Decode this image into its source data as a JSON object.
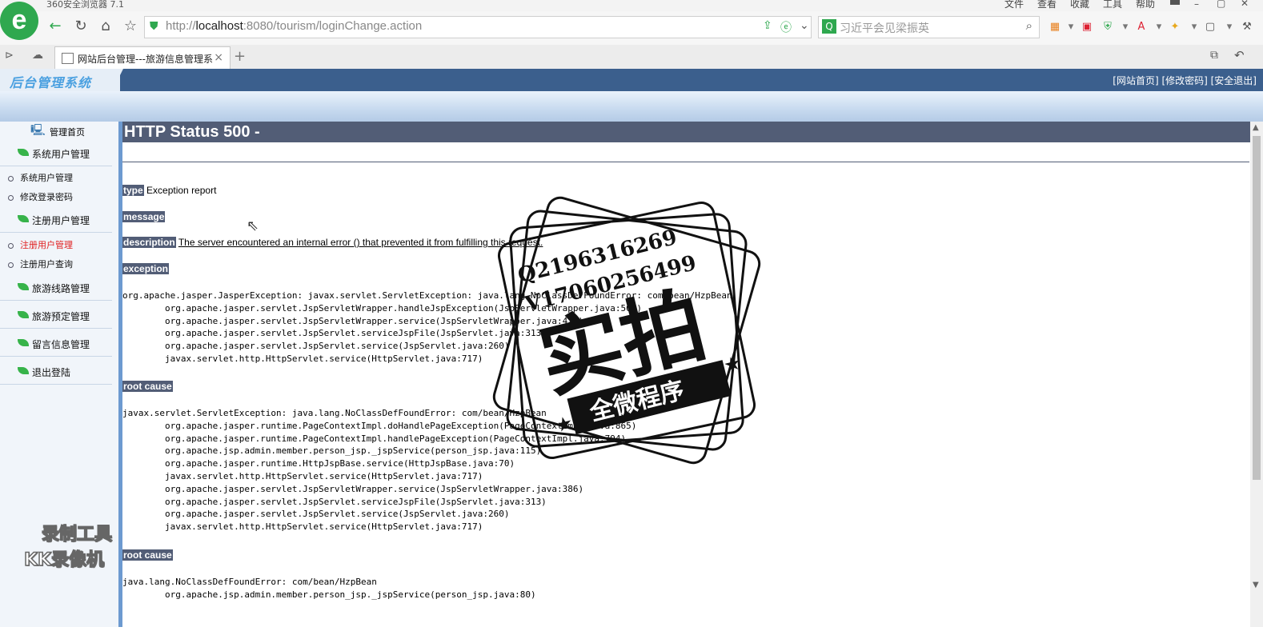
{
  "browser": {
    "app_title": "360安全浏览器 7.1",
    "menu": [
      "文件",
      "查看",
      "收藏",
      "工具",
      "帮助"
    ],
    "url_host": "localhost",
    "url_prefix": "http://",
    "url_rest": ":8080/tourism/loginChange.action",
    "search_placeholder": "习近平会见梁振英",
    "tab_title": "网站后台管理---旅游信息管理系",
    "new_tab": "+"
  },
  "admin": {
    "brand": "后台管理系统",
    "top_links": "[网站首页] [修改密码] [安全退出]",
    "sidebar": {
      "home": "管理首页",
      "groups": [
        {
          "label": "系统用户管理",
          "items": [
            "系统用户管理",
            "修改登录密码"
          ]
        },
        {
          "label": "注册用户管理",
          "items": [
            "注册用户管理",
            "注册用户查询"
          ]
        },
        {
          "label": "旅游线路管理",
          "items": []
        },
        {
          "label": "旅游预定管理",
          "items": []
        },
        {
          "label": "留言信息管理",
          "items": []
        },
        {
          "label": "退出登陆",
          "items": []
        }
      ],
      "active_item_color": "#e02020"
    }
  },
  "error": {
    "title": "HTTP Status 500 -",
    "type_label": "type",
    "type_value": "Exception report",
    "message_label": "message",
    "description_label": "description",
    "description_value": "The server encountered an internal error () that prevented it from fulfilling this request.",
    "exception_label": "exception",
    "exception_trace": "org.apache.jasper.JasperException: javax.servlet.ServletException: java.lang.NoClassDefFoundError: com/bean/HzpBean\n\torg.apache.jasper.servlet.JspServletWrapper.handleJspException(JspServletWrapper.java:500)\n\torg.apache.jasper.servlet.JspServletWrapper.service(JspServletWrapper.java:428)\n\torg.apache.jasper.servlet.JspServlet.serviceJspFile(JspServlet.java:313)\n\torg.apache.jasper.servlet.JspServlet.service(JspServlet.java:260)\n\tjavax.servlet.http.HttpServlet.service(HttpServlet.java:717)",
    "root_cause_label": "root cause",
    "root_cause_trace_1": "javax.servlet.ServletException: java.lang.NoClassDefFoundError: com/bean/HzpBean\n\torg.apache.jasper.runtime.PageContextImpl.doHandlePageException(PageContextImpl.java:865)\n\torg.apache.jasper.runtime.PageContextImpl.handlePageException(PageContextImpl.java:794)\n\torg.apache.jsp.admin.member.person_jsp._jspService(person_jsp.java:115)\n\torg.apache.jasper.runtime.HttpJspBase.service(HttpJspBase.java:70)\n\tjavax.servlet.http.HttpServlet.service(HttpServlet.java:717)\n\torg.apache.jasper.servlet.JspServletWrapper.service(JspServletWrapper.java:386)\n\torg.apache.jasper.servlet.JspServlet.serviceJspFile(JspServlet.java:313)\n\torg.apache.jasper.servlet.JspServlet.service(JspServlet.java:260)\n\tjavax.servlet.http.HttpServlet.service(HttpServlet.java:717)",
    "root_cause_label_2": "root cause",
    "root_cause_trace_2": "java.lang.NoClassDefFoundError: com/bean/HzpBean\n\torg.apache.jsp.admin.member.person_jsp._jspService(person_jsp.java:80)"
  },
  "watermarks": {
    "stamp_line1": "Q2196316269",
    "stamp_line2": "V17060256499",
    "stamp_big": "实拍",
    "stamp_banner": "全微程序",
    "recorder_line1": "录制工具",
    "recorder_line2": "KK录像机"
  },
  "colors": {
    "header_blue": "#3b5f8d",
    "tomcat_label_bg": "#525d76",
    "browser_green": "#2fa84f",
    "sidebar_leaf": "#37b34a"
  }
}
